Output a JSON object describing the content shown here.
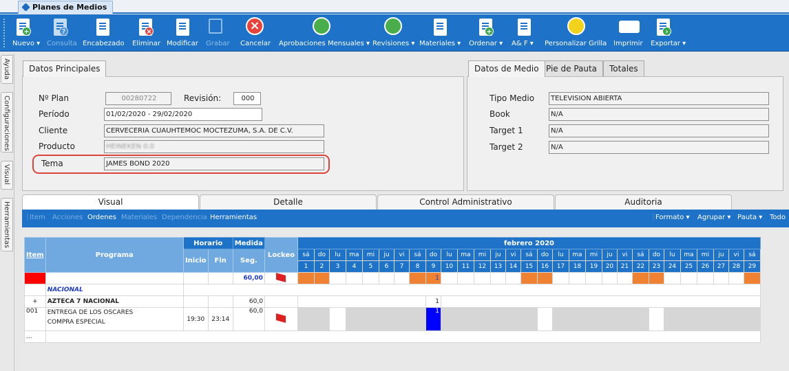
{
  "window_tab": {
    "title": "Planes de Medios",
    "icon": "media-plan-icon"
  },
  "toolbar": {
    "items": [
      {
        "label": "Nuevo ▾",
        "icon": "new-doc-icon",
        "enabled": true
      },
      {
        "label": "Consulta",
        "icon": "query-doc-icon",
        "enabled": false
      },
      {
        "label": "Encabezado",
        "icon": "header-doc-icon",
        "enabled": true
      },
      {
        "label": "Eliminar",
        "icon": "delete-doc-icon",
        "enabled": true
      },
      {
        "label": "Modificar",
        "icon": "edit-doc-icon",
        "enabled": true
      },
      {
        "label": "Grabar",
        "icon": "save-icon",
        "enabled": false
      },
      {
        "label": "Cancelar",
        "icon": "cancel-icon",
        "enabled": true
      },
      {
        "label": "Aprobaciones Mensuales ▾",
        "icon": "thumbs-up-icon",
        "enabled": true
      },
      {
        "label": "Revisiones ▾",
        "icon": "thumbs-up-icon",
        "enabled": true
      },
      {
        "label": "Materiales ▾",
        "icon": "materials-icon",
        "enabled": true
      },
      {
        "label": "Ordenar ▾",
        "icon": "order-icon",
        "enabled": true
      },
      {
        "label": "A& F ▾",
        "icon": "af-icon",
        "enabled": true
      },
      {
        "label": "Personalizar Grilla",
        "icon": "grid-icon",
        "enabled": true
      },
      {
        "label": "Imprimir",
        "icon": "printer-icon",
        "enabled": true
      },
      {
        "label": "Exportar ▾",
        "icon": "export-icon",
        "enabled": true
      }
    ]
  },
  "sidebar": {
    "tabs": [
      "Ayuda",
      "Configuraciones",
      "Visual",
      "Herramientas"
    ]
  },
  "principales": {
    "tab": "Datos Principales",
    "plan_label": "Nº Plan",
    "plan_value": "00280722",
    "revision_label": "Revisión:",
    "revision_value": "000",
    "periodo_label": "Período",
    "periodo_value": "01/02/2020 - 29/02/2020",
    "cliente_label": "Cliente",
    "cliente_value": "CERVECERIA CUAUHTEMOC MOCTEZUMA, S.A. DE C.V.",
    "producto_label": "Producto",
    "producto_value": "HEINEKEN 0.0",
    "tema_label": "Tema",
    "tema_value": "JAMES BOND 2020"
  },
  "medio": {
    "tabs": [
      "Datos de Medio",
      "Pie de Pauta",
      "Totales"
    ],
    "tipo_label": "Tipo Medio",
    "tipo_value": "TELEVISION ABIERTA",
    "book_label": "Book",
    "book_value": "N/A",
    "target1_label": "Target 1",
    "target1_value": "N/A",
    "target2_label": "Target 2",
    "target2_value": "N/A"
  },
  "main_tabs": [
    "Visual",
    "Detalle",
    "Control Administrativo",
    "Auditoria"
  ],
  "grid_toolbar": {
    "left": [
      {
        "label": "Item",
        "enabled": false
      },
      {
        "label": "Acciones",
        "enabled": false
      },
      {
        "label": "Ordenes",
        "enabled": true
      },
      {
        "label": "Materiales",
        "enabled": false
      },
      {
        "label": "Dependencia",
        "enabled": false
      },
      {
        "label": "Herramientas",
        "enabled": true
      }
    ],
    "right": [
      "Formato ▾",
      "Agrupar ▾",
      "Pauta ▾",
      "Todo"
    ]
  },
  "grid": {
    "headers": {
      "item": "Item",
      "programa": "Programa",
      "horario": "Horario",
      "inicio": "Inicio",
      "fin": "Fin",
      "medida": "Medida",
      "seg": "Seg.",
      "lockeo": "Lockeo",
      "month": "febrero 2020"
    },
    "days": [
      "sá",
      "do",
      "lu",
      "ma",
      "mi",
      "ju",
      "vi",
      "sá",
      "do",
      "lu",
      "ma",
      "mi",
      "ju",
      "vi",
      "sá",
      "do",
      "lu",
      "ma",
      "mi",
      "ju",
      "vi",
      "sá",
      "do",
      "lu",
      "ma",
      "mi",
      "ju",
      "vi",
      "sá"
    ],
    "dates": [
      "1",
      "2",
      "3",
      "4",
      "5",
      "6",
      "7",
      "8",
      "9",
      "10",
      "11",
      "12",
      "13",
      "14",
      "15",
      "16",
      "17",
      "18",
      "19",
      "20",
      "21",
      "22",
      "23",
      "24",
      "25",
      "26",
      "27",
      "28",
      "29"
    ],
    "total_seg": "60,00",
    "total_count": "1",
    "group": "NACIONAL",
    "subgroup": {
      "expander": "+",
      "name": "AZTECA 7 NACIONAL",
      "seg": "60,0",
      "count": "1"
    },
    "row": {
      "item": "001",
      "programa_line1": "ENTREGA DE LOS OSCARES",
      "programa_line2": "COMPRA ESPECIAL",
      "inicio": "19:30",
      "fin": "23:14",
      "seg": "60,0",
      "count": "1"
    },
    "ellipsis": "..."
  },
  "colors": {
    "accent": "#1e73c8",
    "weekend": "#ee8232",
    "highlight_border": "#d9453a",
    "selected_day": "#0000ff"
  }
}
